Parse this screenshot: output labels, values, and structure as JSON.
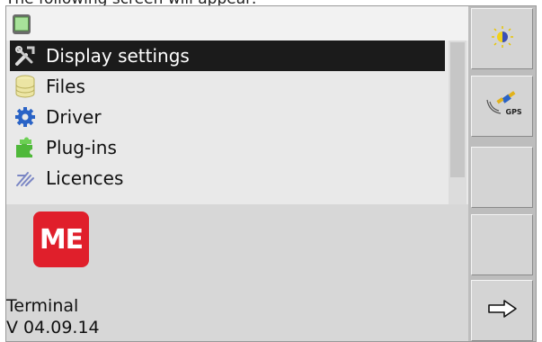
{
  "caption": "The following screen will appear:",
  "menu": {
    "items": [
      {
        "label": "Display settings",
        "icon": "tools-icon",
        "selected": true
      },
      {
        "label": "Files",
        "icon": "database-icon",
        "selected": false
      },
      {
        "label": "Driver",
        "icon": "gear-icon",
        "selected": false
      },
      {
        "label": "Plug-ins",
        "icon": "puzzle-icon",
        "selected": false
      },
      {
        "label": "Licences",
        "icon": "licence-icon",
        "selected": false
      }
    ]
  },
  "info": {
    "logo_text": "ME",
    "product": "Terminal",
    "version": "V 04.09.14"
  },
  "softkeys": {
    "brightness_icon": "brightness-icon",
    "gps_label": "GPS",
    "next_icon": "arrow-right-icon"
  },
  "colors": {
    "selected_bg": "#1b1b1b",
    "logo_red": "#e01f2b"
  }
}
